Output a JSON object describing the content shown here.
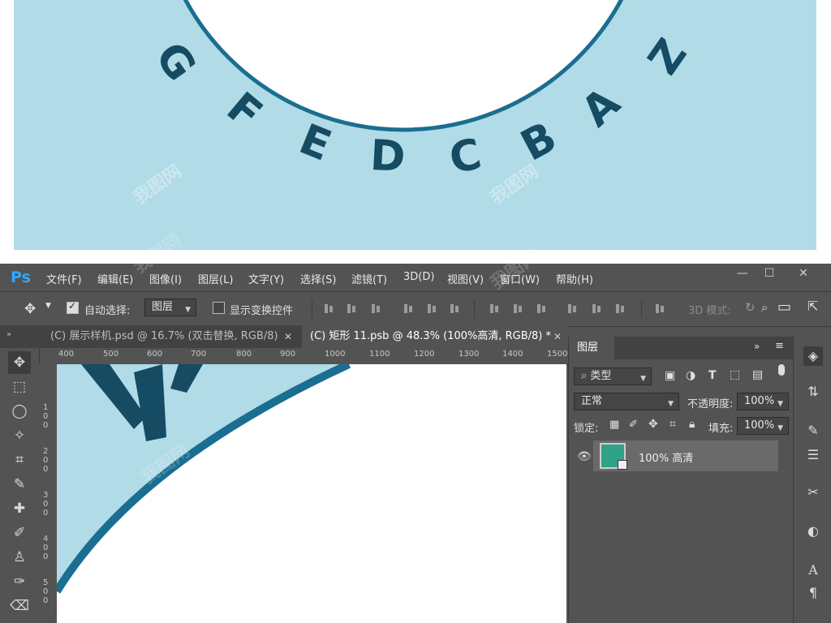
{
  "preview": {
    "ring_letters": [
      "A",
      "B",
      "C",
      "D",
      "E",
      "F",
      "G",
      "Z"
    ],
    "colors": {
      "background": "#b1dbe6",
      "ring": "#1a6e91",
      "letters": "#154b63"
    }
  },
  "app": {
    "logo": "Ps"
  },
  "menu": [
    {
      "label": "文件(F)"
    },
    {
      "label": "编辑(E)"
    },
    {
      "label": "图像(I)"
    },
    {
      "label": "图层(L)"
    },
    {
      "label": "文字(Y)"
    },
    {
      "label": "选择(S)"
    },
    {
      "label": "滤镜(T)"
    },
    {
      "label": "3D(D)"
    },
    {
      "label": "视图(V)"
    },
    {
      "label": "窗口(W)"
    },
    {
      "label": "帮助(H)"
    }
  ],
  "window_controls": {
    "minimize": "—",
    "maximize": "☐",
    "close": "✕"
  },
  "options": {
    "auto_select_label": "自动选择:",
    "auto_select_checked": true,
    "auto_select_target": "图层",
    "show_transform_label": "显示变换控件",
    "show_transform_checked": false,
    "mode_3d_label": "3D 模式:"
  },
  "tabs": [
    {
      "label": "(C) 展示样机.psd @ 16.7% (双击替换, RGB/8)",
      "close": "✕"
    },
    {
      "label": "(C) 矩形 11.psb @ 48.3% (100%高清, RGB/8) *",
      "close": "✕"
    }
  ],
  "ruler": {
    "top": [
      "400",
      "500",
      "600",
      "700",
      "800",
      "900",
      "1000",
      "1100",
      "1200",
      "1300",
      "1400",
      "1500"
    ],
    "left": [
      "100",
      "200",
      "300",
      "400",
      "500"
    ]
  },
  "layers_panel": {
    "title": "图层",
    "filter_label": "类型",
    "blend_mode": "正常",
    "opacity_label": "不透明度:",
    "opacity_value": "100%",
    "lock_label": "锁定:",
    "fill_label": "填充:",
    "fill_value": "100%",
    "layers": [
      {
        "name": "100% 高清",
        "thumb_color": "#2fa38a",
        "visible": true
      }
    ]
  },
  "tools": [
    {
      "icon": "move-icon",
      "glyph": "✥"
    },
    {
      "icon": "marquee-icon",
      "glyph": "⬚"
    },
    {
      "icon": "lasso-icon",
      "glyph": "◯"
    },
    {
      "icon": "magic-wand-icon",
      "glyph": "✧"
    },
    {
      "icon": "crop-icon",
      "glyph": "⌗"
    },
    {
      "icon": "eyedropper-icon",
      "glyph": "✎"
    },
    {
      "icon": "healing-brush-icon",
      "glyph": "✚"
    },
    {
      "icon": "brush-icon",
      "glyph": "✐"
    },
    {
      "icon": "stamp-icon",
      "glyph": "♙"
    },
    {
      "icon": "history-brush-icon",
      "glyph": "✑"
    },
    {
      "icon": "eraser-icon",
      "glyph": "⌫"
    }
  ],
  "watermark": "我图网"
}
